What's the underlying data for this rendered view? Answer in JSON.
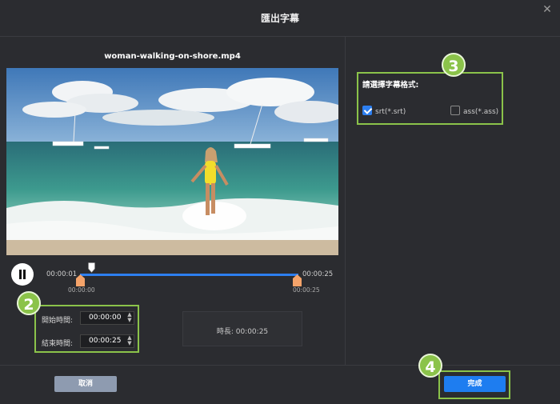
{
  "dialog": {
    "title": "匯出字幕",
    "close_glyph": "✕"
  },
  "preview": {
    "filename": "woman-walking-on-shore.mp4",
    "current_time": "00:00:01",
    "end_time": "00:00:25",
    "handle_start_time": "00:00:00",
    "handle_end_time": "00:00:25",
    "playhead_progress": 0.04
  },
  "range": {
    "start_label": "開始時間:",
    "start_value": "00:00:00",
    "end_label": "結束時間:",
    "end_value": "00:00:25",
    "duration_text": "時長:  00:00:25"
  },
  "format": {
    "title": "請選擇字幕格式:",
    "options": [
      {
        "label": "srt(*.srt)",
        "checked": true
      },
      {
        "label": "ass(*.ass)",
        "checked": false
      }
    ]
  },
  "badges": [
    "2",
    "3",
    "4"
  ],
  "footer": {
    "cancel_label": "取消",
    "done_label": "完成"
  },
  "colors": {
    "accent": "#1e7df0",
    "highlight": "#8bc34a",
    "handle": "#f4a36a"
  },
  "icons": {
    "close": "close-icon",
    "pause": "pause-icon",
    "spinner": "spinner-arrows-icon",
    "checkbox": "checkbox-icon"
  }
}
